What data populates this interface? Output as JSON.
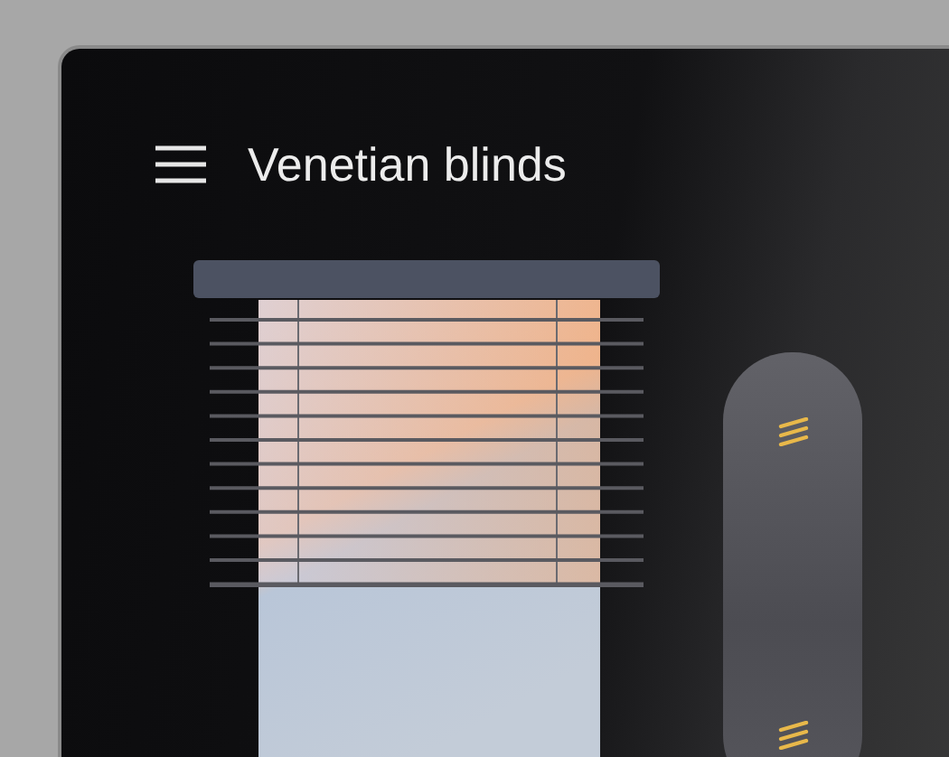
{
  "header": {
    "title": "Venetian blinds"
  }
}
